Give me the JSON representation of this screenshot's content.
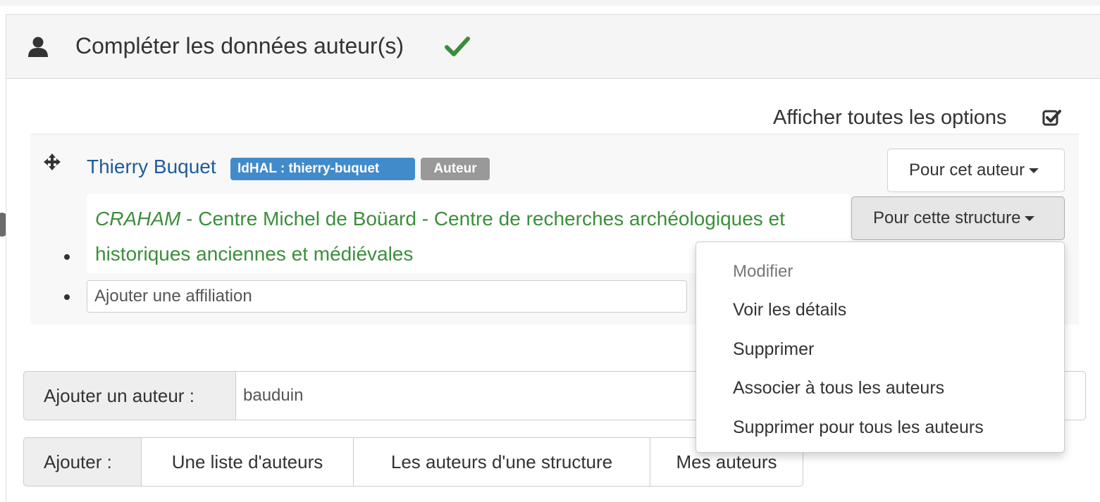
{
  "panel": {
    "title": "Compléter les données auteur(s)",
    "options_link": "Afficher toutes les options"
  },
  "author": {
    "name": "Thierry Buquet",
    "idhal_badge": "IdHAL : thierry-buquet",
    "role_badge": "Auteur",
    "author_button": "Pour cet auteur",
    "affiliation": {
      "acronym": "CRAHAM",
      "name_line1": " - Centre Michel de Boüard - Centre de recherches archéologiques et",
      "name_line2": "historiques anciennes et médiévales"
    },
    "structure_button": "Pour cette structure",
    "add_affiliation_placeholder": "Ajouter une affiliation"
  },
  "structure_menu": {
    "header": "Modifier",
    "items": [
      "Voir les détails",
      "Supprimer",
      "Associer à tous les auteurs",
      "Supprimer pour tous les auteurs"
    ]
  },
  "add_author": {
    "label": "Ajouter un auteur :",
    "value": "bauduin"
  },
  "add": {
    "label": "Ajouter :",
    "buttons": [
      "Une liste d'auteurs",
      "Les auteurs d'une structure",
      "Mes auteurs"
    ]
  },
  "colors": {
    "link_blue": "#1f5c99",
    "badge_blue": "#428bca",
    "badge_gray": "#999999",
    "affiliation_green": "#3b8f3b",
    "check_green": "#3c8c3c"
  },
  "icons": [
    "user-icon",
    "check-icon",
    "check-square-icon",
    "move-icon",
    "caret-down-icon"
  ]
}
